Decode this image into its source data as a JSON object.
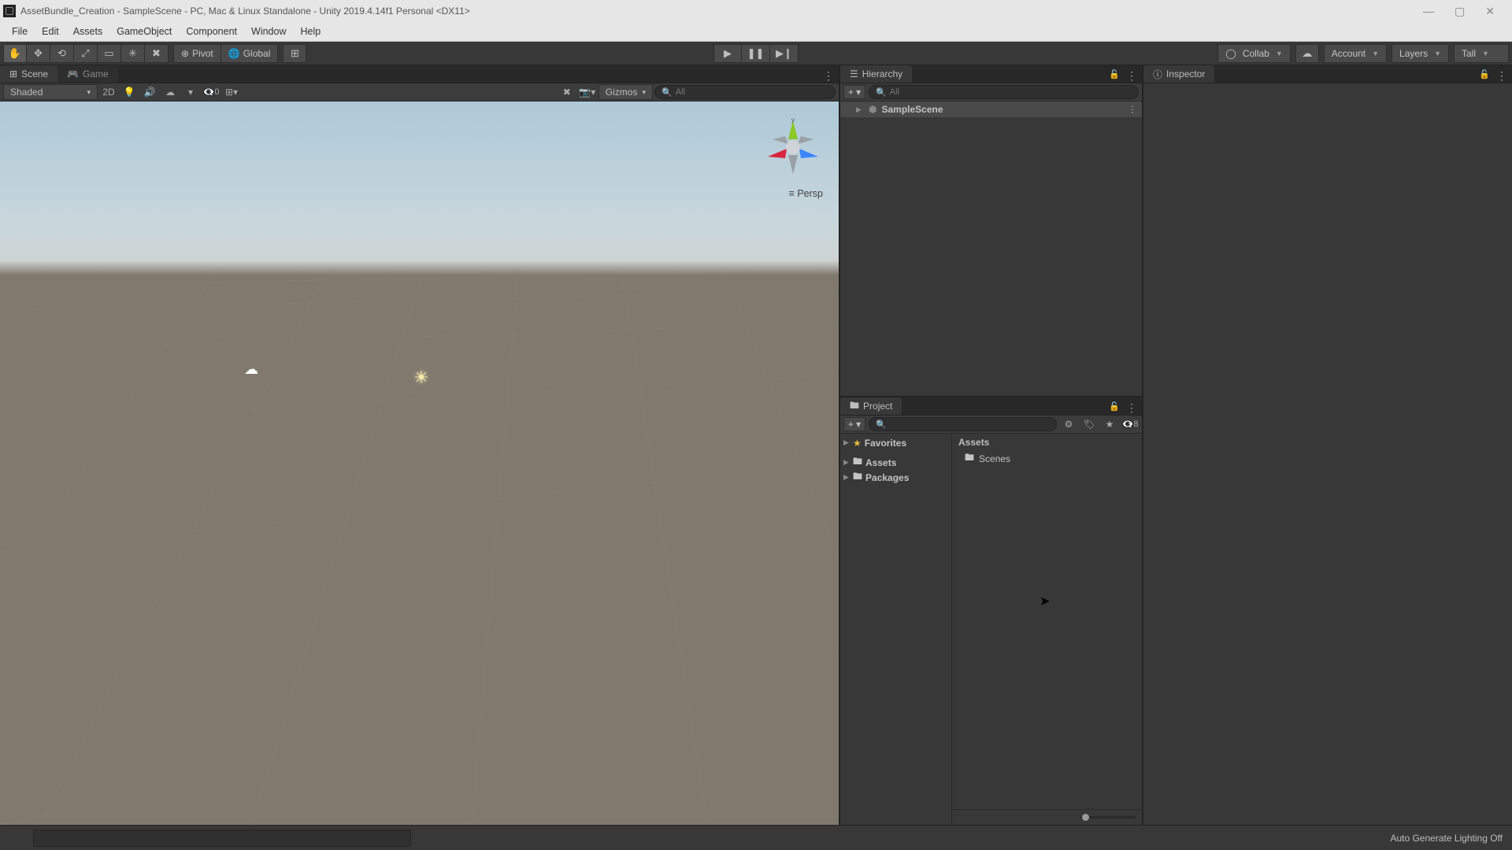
{
  "window": {
    "title": "AssetBundle_Creation - SampleScene - PC, Mac & Linux Standalone - Unity 2019.4.14f1 Personal <DX11>"
  },
  "menu": {
    "file": "File",
    "edit": "Edit",
    "assets": "Assets",
    "gameobject": "GameObject",
    "component": "Component",
    "window": "Window",
    "help": "Help"
  },
  "toolbar": {
    "pivot": "Pivot",
    "global": "Global",
    "collab": "Collab",
    "account": "Account",
    "layers": "Layers",
    "layout": "Tall"
  },
  "scene": {
    "tab_scene": "Scene",
    "tab_game": "Game",
    "shading": "Shaded",
    "mode_2d": "2D",
    "gizmos": "Gizmos",
    "hidden_count": "0",
    "search_placeholder": "All",
    "persp": "Persp"
  },
  "hierarchy": {
    "title": "Hierarchy",
    "search_placeholder": "All",
    "root": "SampleScene"
  },
  "project": {
    "title": "Project",
    "favorites": "Favorites",
    "assets": "Assets",
    "packages": "Packages",
    "breadcrumb": "Assets",
    "item_scenes": "Scenes",
    "hidden": "8"
  },
  "inspector": {
    "title": "Inspector"
  },
  "status": {
    "lighting": "Auto Generate Lighting Off"
  }
}
